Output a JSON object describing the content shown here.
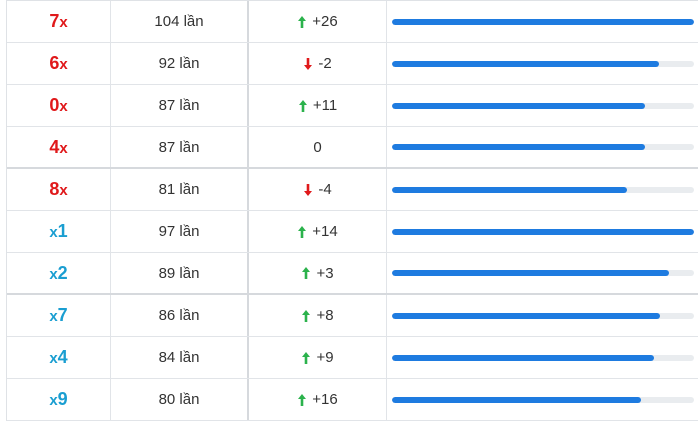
{
  "colors": {
    "red_number": "#e0191b",
    "teal_number": "#1a9ed1",
    "arrow_up": "#2bb24c",
    "arrow_down": "#e0191b",
    "bar_fill": "#1e7be0",
    "bar_track": "#e9ecef"
  },
  "rows": [
    {
      "digit": "7",
      "mark": "x",
      "mark_pos": "suffix",
      "color": "red",
      "count": "104 lần",
      "trend": "up",
      "delta": "+26",
      "fraction": 1.0
    },
    {
      "digit": "6",
      "mark": "x",
      "mark_pos": "suffix",
      "color": "red",
      "count": "92 lần",
      "trend": "down",
      "delta": "-2",
      "fraction": 0.885
    },
    {
      "digit": "0",
      "mark": "x",
      "mark_pos": "suffix",
      "color": "red",
      "count": "87 lần",
      "trend": "up",
      "delta": "+11",
      "fraction": 0.837
    },
    {
      "digit": "4",
      "mark": "x",
      "mark_pos": "suffix",
      "color": "red",
      "count": "87 lần",
      "trend": "none",
      "delta": "0",
      "fraction": 0.837
    },
    {
      "digit": "8",
      "mark": "x",
      "mark_pos": "suffix",
      "color": "red",
      "count": "81 lần",
      "trend": "down",
      "delta": "-4",
      "fraction": 0.779
    },
    {
      "digit": "1",
      "mark": "x",
      "mark_pos": "prefix",
      "color": "teal",
      "count": "97 lần",
      "trend": "up",
      "delta": "+14",
      "fraction": 1.0
    },
    {
      "digit": "2",
      "mark": "x",
      "mark_pos": "prefix",
      "color": "teal",
      "count": "89 lần",
      "trend": "up",
      "delta": "+3",
      "fraction": 0.918
    },
    {
      "digit": "7",
      "mark": "x",
      "mark_pos": "prefix",
      "color": "teal",
      "count": "86 lần",
      "trend": "up",
      "delta": "+8",
      "fraction": 0.887
    },
    {
      "digit": "4",
      "mark": "x",
      "mark_pos": "prefix",
      "color": "teal",
      "count": "84 lần",
      "trend": "up",
      "delta": "+9",
      "fraction": 0.866
    },
    {
      "digit": "9",
      "mark": "x",
      "mark_pos": "prefix",
      "color": "teal",
      "count": "80 lần",
      "trend": "up",
      "delta": "+16",
      "fraction": 0.825
    }
  ]
}
